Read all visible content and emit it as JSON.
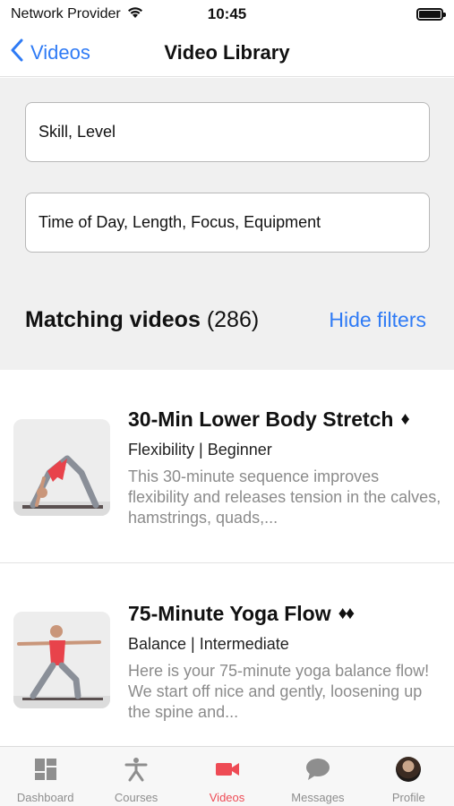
{
  "status_bar": {
    "carrier": "Network Provider",
    "time": "10:45"
  },
  "nav": {
    "back_label": "Videos",
    "title": "Video Library"
  },
  "filters": {
    "field_1": "Skill, Level",
    "field_2": "Time of Day, Length, Focus, Equipment",
    "matching_label": "Matching videos",
    "matching_count": "(286)",
    "hide_filters_label": "Hide filters"
  },
  "videos": [
    {
      "title": "30-Min Lower Body Stretch",
      "difficulty": "♦",
      "meta": "Flexibility | Beginner",
      "description": "This 30-minute sequence improves flexibility and releases tension in the calves, hamstrings, quads,..."
    },
    {
      "title": "75-Minute Yoga Flow",
      "difficulty": "♦♦",
      "meta": "Balance | Intermediate",
      "description": "Here is your 75-minute yoga balance flow! We start off nice and gently, loosening up the spine and..."
    }
  ],
  "tabs": [
    {
      "label": "Dashboard",
      "icon": "dashboard-icon"
    },
    {
      "label": "Courses",
      "icon": "person-stretch-icon"
    },
    {
      "label": "Videos",
      "icon": "video-camera-icon"
    },
    {
      "label": "Messages",
      "icon": "chat-bubble-icon"
    },
    {
      "label": "Profile",
      "icon": "avatar"
    }
  ],
  "colors": {
    "accent_blue": "#2f7bf5",
    "active_tab": "#ee4b55",
    "filter_background": "#f0f0f0"
  }
}
